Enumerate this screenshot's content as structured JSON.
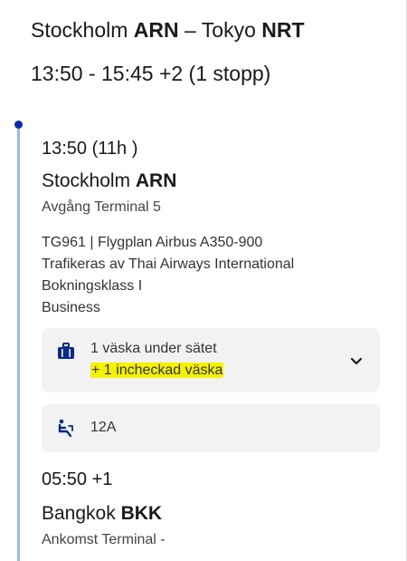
{
  "header": {
    "route_origin_city": "Stockholm",
    "route_origin_code": "ARN",
    "route_separator": "–",
    "route_dest_city": "Tokyo",
    "route_dest_code": "NRT",
    "times": "13:50 - 15:45 +2 (1 stopp)"
  },
  "segment": {
    "departure_time": "13:50 (11h )",
    "departure_city": "Stockholm",
    "departure_code": "ARN",
    "departure_terminal": "Avgång Terminal 5",
    "flight_info": "TG961 | Flygplan Airbus A350-900",
    "operated_by": "Trafikeras av Thai Airways International",
    "booking_class": "Bokningsklass I",
    "cabin": "Business",
    "baggage": {
      "under_seat": "1 väska under sätet",
      "checked": "+ 1 incheckad väska",
      "icon": "luggage-icon",
      "expand_icon": "chevron-down-icon"
    },
    "seat": {
      "number": "12A",
      "icon": "seat-icon"
    },
    "arrival_time": "05:50 +1",
    "arrival_city": "Bangkok",
    "arrival_code": "BKK",
    "arrival_terminal": "Ankomst Terminal -"
  },
  "colors": {
    "timeline": "#8ec1e6",
    "timeline_dot": "#0a2bb0",
    "icon": "#0a2a8a",
    "highlight": "#f5f200",
    "card_bg": "#f2f2f2"
  }
}
